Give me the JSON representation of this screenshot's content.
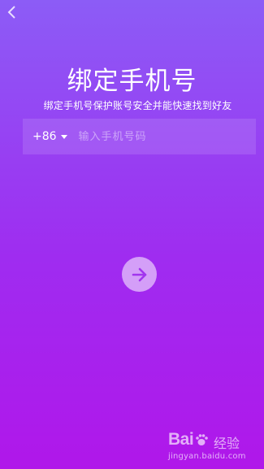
{
  "header": {
    "back_icon": "chevron-left-icon"
  },
  "title": "绑定手机号",
  "subtitle": "绑定手机号保护账号安全并能快速找到好友",
  "phone_form": {
    "country_code": "+86",
    "caret_icon": "caret-down-icon",
    "phone_placeholder": "输入手机号码",
    "phone_value": ""
  },
  "next_button": {
    "icon": "arrow-right-icon"
  },
  "watermark": {
    "logo_left": "Bai",
    "logo_right": "经验",
    "url": "jingyan.baidu.com"
  },
  "colors": {
    "background_top": "#8c5cf6",
    "background_bottom": "#b017ea",
    "arrow": "#a235ee"
  }
}
